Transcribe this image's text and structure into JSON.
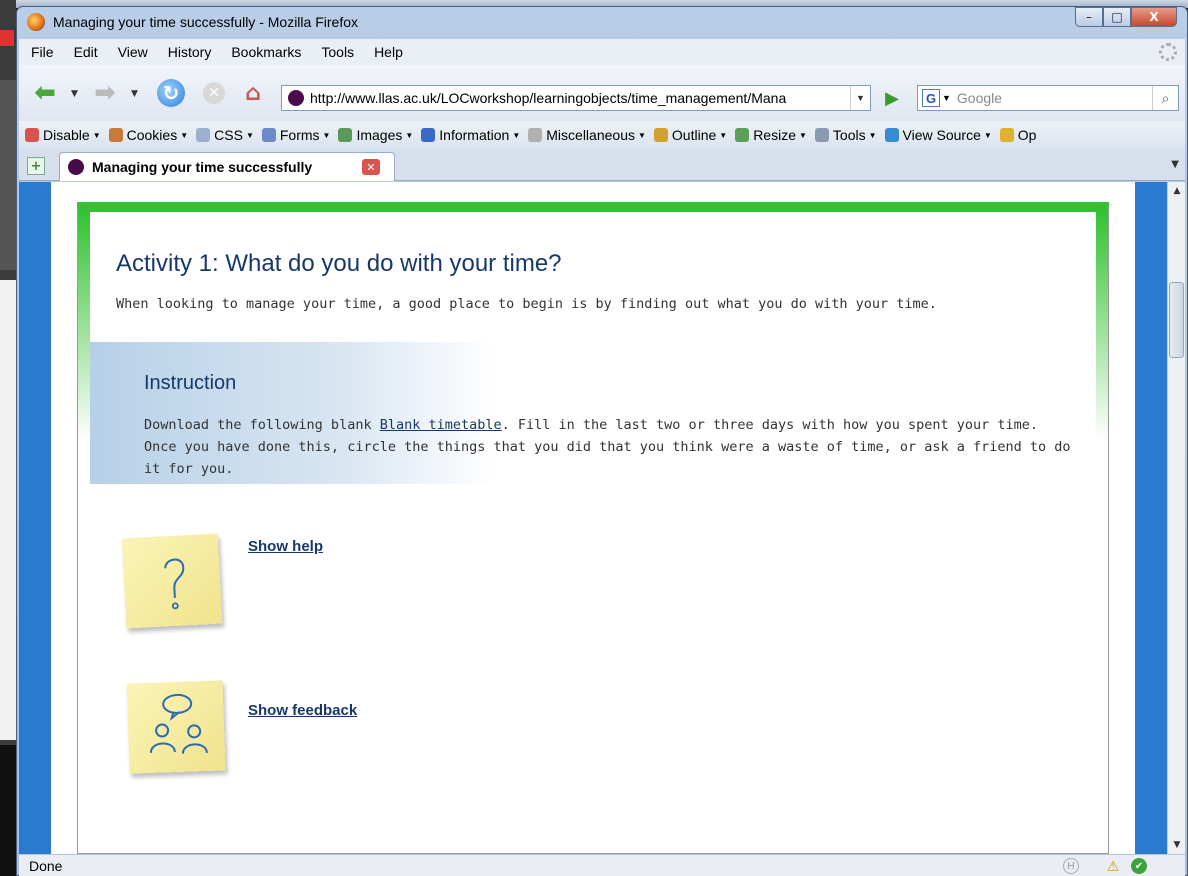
{
  "window": {
    "title": "Managing your time successfully - Mozilla Firefox",
    "controls": {
      "minimize": "–",
      "maximize": "□",
      "close": "X"
    }
  },
  "menu": [
    "File",
    "Edit",
    "View",
    "History",
    "Bookmarks",
    "Tools",
    "Help"
  ],
  "navigation": {
    "url": "http://www.llas.ac.uk/LOCworkshop/learningobjects/time_management/Mana",
    "search_placeholder": "Google",
    "search_engine": "G"
  },
  "dev_toolbar": [
    {
      "label": "Disable",
      "icon": "disable-icon",
      "color": "#d9534f"
    },
    {
      "label": "Cookies",
      "icon": "cookies-icon",
      "color": "#c87a3a"
    },
    {
      "label": "CSS",
      "icon": "css-icon",
      "color": "#9ab0d0"
    },
    {
      "label": "Forms",
      "icon": "forms-icon",
      "color": "#6a8ac8"
    },
    {
      "label": "Images",
      "icon": "images-icon",
      "color": "#5a9a5a"
    },
    {
      "label": "Information",
      "icon": "information-icon",
      "color": "#3a6ac8"
    },
    {
      "label": "Miscellaneous",
      "icon": "miscellaneous-icon",
      "color": "#b0b0b0"
    },
    {
      "label": "Outline",
      "icon": "outline-icon",
      "color": "#d0a030"
    },
    {
      "label": "Resize",
      "icon": "resize-icon",
      "color": "#5aa05a"
    },
    {
      "label": "Tools",
      "icon": "tools-icon",
      "color": "#8a9ab0"
    },
    {
      "label": "View Source",
      "icon": "view-source-icon",
      "color": "#3a8ad0"
    },
    {
      "label": "Op",
      "icon": "options-icon",
      "color": "#e0b030"
    }
  ],
  "tabs": [
    {
      "label": "Managing your time successfully",
      "active": true
    }
  ],
  "content": {
    "activity_title": "Activity 1: What do you do with your time?",
    "activity_intro": "When looking to manage your time, a good place to begin is by finding out what you do with your time.",
    "instruction_heading": "Instruction",
    "instruction_before_link": "Download the following blank ",
    "instruction_link": "Blank timetable",
    "instruction_after_link": ". Fill in the last two or three days with how you spent your time. Once you have done this, circle the things that you did that you think were a waste of time, or ask a friend to do it for you.",
    "show_help": "Show help",
    "show_feedback": "Show feedback"
  },
  "status": {
    "text": "Done"
  },
  "colors": {
    "accent_green": "#34c232",
    "page_blue": "#2a7ad0",
    "heading_navy": "#16386a"
  }
}
